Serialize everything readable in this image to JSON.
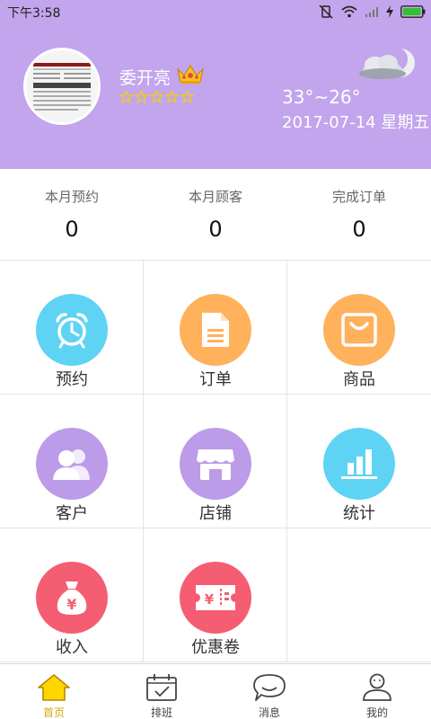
{
  "status_bar": {
    "time": "下午3:58"
  },
  "profile": {
    "name": "委开亮",
    "star_rating": 0,
    "star_count": 5
  },
  "weather": {
    "temperature": "33°~26°",
    "date": "2017-07-14  星期五"
  },
  "stats": [
    {
      "label": "本月预约",
      "value": "0"
    },
    {
      "label": "本月顾客",
      "value": "0"
    },
    {
      "label": "完成订单",
      "value": "0"
    }
  ],
  "menu": [
    {
      "label": "预约",
      "icon": "alarm-clock-icon",
      "color": "#5fd3f3"
    },
    {
      "label": "订单",
      "icon": "document-icon",
      "color": "#ffb15c"
    },
    {
      "label": "商品",
      "icon": "shopping-bag-icon",
      "color": "#ffb15c"
    },
    {
      "label": "客户",
      "icon": "users-icon",
      "color": "#bc9be8"
    },
    {
      "label": "店铺",
      "icon": "store-icon",
      "color": "#bc9be8"
    },
    {
      "label": "统计",
      "icon": "bar-chart-icon",
      "color": "#5fd3f3"
    },
    {
      "label": "收入",
      "icon": "money-bag-icon",
      "color": "#f55d72"
    },
    {
      "label": "优惠卷",
      "icon": "coupon-icon",
      "color": "#f55d72"
    }
  ],
  "tabs": [
    {
      "label": "首页",
      "icon": "home-icon",
      "active": true
    },
    {
      "label": "排班",
      "icon": "calendar-icon",
      "active": false
    },
    {
      "label": "消息",
      "icon": "message-icon",
      "active": false
    },
    {
      "label": "我的",
      "icon": "user-icon",
      "active": false
    }
  ],
  "colors": {
    "header_bg": "#c2a5ec",
    "active_tab": "#d8a40a",
    "star": "#f5d000"
  }
}
